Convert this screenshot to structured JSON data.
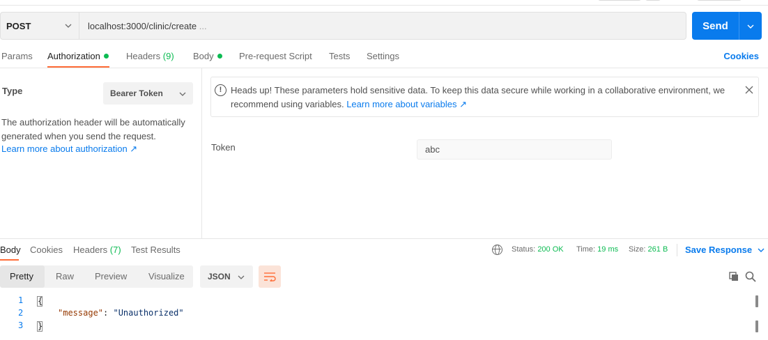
{
  "request": {
    "method": "POST",
    "url": "localhost:3000/clinic/create",
    "url_overflow": "...",
    "send_label": "Send"
  },
  "request_tabs": {
    "params": "Params",
    "authorization": "Authorization",
    "headers": "Headers",
    "headers_count": "(9)",
    "body": "Body",
    "prerequest": "Pre-request Script",
    "tests": "Tests",
    "settings": "Settings",
    "cookies": "Cookies"
  },
  "auth": {
    "type_label": "Type",
    "type_value": "Bearer Token",
    "description": "The authorization header will be automatically generated when you send the request.",
    "learn_more": "Learn more about authorization ↗",
    "alert_text": "Heads up! These parameters hold sensitive data. To keep this data secure while working in a collaborative environment, we recommend using variables.",
    "alert_link": "Learn more about variables ↗",
    "token_label": "Token",
    "token_value": "abc"
  },
  "response": {
    "tabs": {
      "body": "Body",
      "cookies": "Cookies",
      "headers": "Headers",
      "headers_count": "(7)",
      "test_results": "Test Results"
    },
    "status_label": "Status:",
    "status_value": "200 OK",
    "time_label": "Time:",
    "time_value": "19 ms",
    "size_label": "Size:",
    "size_value": "261 B",
    "save_label": "Save Response",
    "view_modes": [
      "Pretty",
      "Raw",
      "Preview",
      "Visualize"
    ],
    "format": "JSON",
    "code": {
      "line_numbers": [
        "1",
        "2",
        "3"
      ],
      "open_brace": "{",
      "key": "\"message\"",
      "colon": ": ",
      "value": "\"Unauthorized\"",
      "close_brace": "}"
    }
  },
  "icons": {
    "method_chevron": "chevron-down-icon",
    "send_chevron": "chevron-down-icon",
    "alert": "info-circle-icon",
    "close": "close-icon",
    "globe": "globe-icon",
    "wrap": "wrap-lines-icon",
    "copy": "copy-icon",
    "search": "search-icon"
  },
  "colors": {
    "accent_blue": "#097bed",
    "success_green": "#0cbb52",
    "tab_underline": "#ff6c37"
  }
}
